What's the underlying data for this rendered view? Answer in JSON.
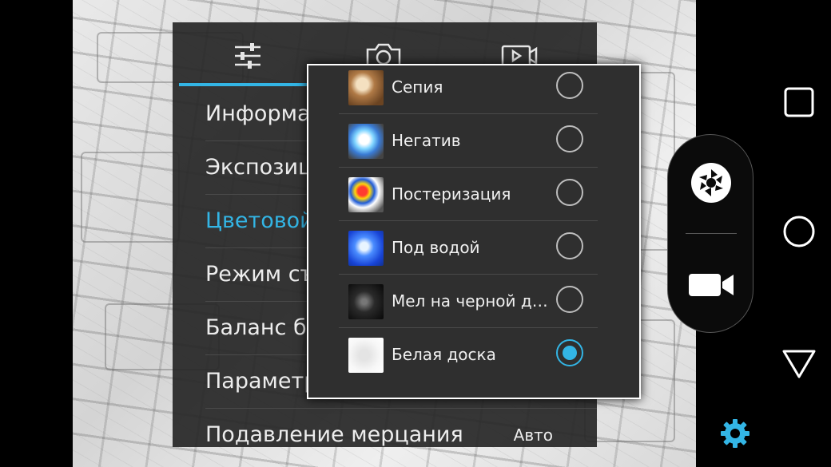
{
  "settings": {
    "tabs": [
      "general-tab",
      "photo-tab",
      "video-tab"
    ],
    "menu": [
      {
        "label": "Информация о камере",
        "active": false
      },
      {
        "label": "Экспозиция",
        "active": false
      },
      {
        "label": "Цветовой эффект",
        "active": true
      },
      {
        "label": "Режим съемки",
        "active": false
      },
      {
        "label": "Баланс белого",
        "active": false
      },
      {
        "label": "Параметры",
        "active": false
      },
      {
        "label": "Подавление мерцания",
        "active": false,
        "value": "Авто"
      }
    ]
  },
  "color_effect_dialog": {
    "options": [
      {
        "label": "Сепия",
        "selected": false
      },
      {
        "label": "Негатив",
        "selected": false
      },
      {
        "label": "Постеризация",
        "selected": false
      },
      {
        "label": "Под водой",
        "selected": false
      },
      {
        "label": "Мел на черной доске",
        "selected": false
      },
      {
        "label": "Белая доска",
        "selected": true
      }
    ]
  },
  "controls": {
    "shutter_icon": "aperture-icon",
    "video_icon": "video-camera-icon",
    "settings_icon": "gear-icon"
  },
  "navbar": {
    "icons": [
      "recents-icon",
      "home-icon",
      "back-icon"
    ]
  },
  "colors": {
    "accent": "#33b5e5",
    "panel": "#262626",
    "dialog": "#2f2f2f"
  }
}
